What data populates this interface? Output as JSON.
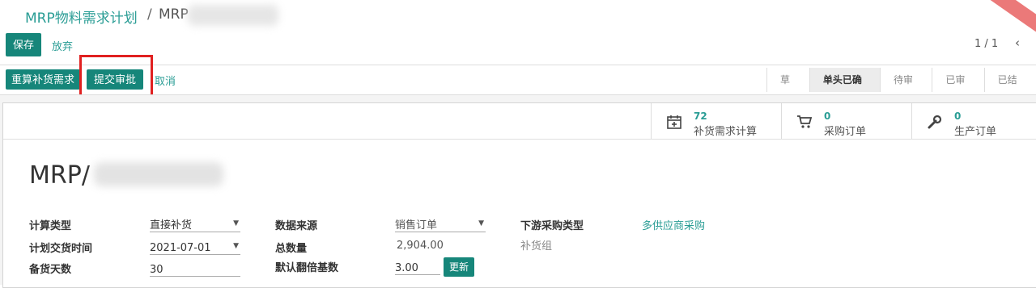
{
  "breadcrumb": {
    "parent": "MRP物料需求计划",
    "separator": "/",
    "current": "MRP"
  },
  "ribbon": "",
  "toolbar": {
    "save": "保存",
    "discard": "放弃",
    "pager": "1 / 1",
    "prev": "‹"
  },
  "actions": {
    "recalc": "重算补货需求",
    "submit": "提交审批",
    "cancel": "取消"
  },
  "status_stages": [
    {
      "label": "草稿",
      "active": false
    },
    {
      "label": "单头已确认",
      "active": true
    },
    {
      "label": "待审批",
      "active": false
    },
    {
      "label": "已审批",
      "active": false
    },
    {
      "label": "已结案",
      "active": false
    }
  ],
  "smart_buttons": [
    {
      "count": "72",
      "label": "补货需求计算",
      "icon": "calendar-plus-icon"
    },
    {
      "count": "0",
      "label": "采购订单",
      "icon": "cart-icon"
    },
    {
      "count": "0",
      "label": "生产订单",
      "icon": "wrench-icon"
    }
  ],
  "record": {
    "title": "MRP/"
  },
  "fields": {
    "calc_type": {
      "label": "计算类型",
      "value": "直接补货"
    },
    "delivery_time": {
      "label": "计划交货时间",
      "value": "2021-07-01"
    },
    "stock_days": {
      "label": "备货天数",
      "value": "30"
    },
    "data_source": {
      "label": "数据来源",
      "value": "销售订单"
    },
    "total_qty": {
      "label": "总数量",
      "value": "2,904.00"
    },
    "multiple": {
      "label": "默认翻倍基数",
      "value": "3.00",
      "button": "更新"
    },
    "downstream": {
      "label": "下游采购类型",
      "value": "多供应商采购"
    },
    "replenish_group": {
      "label": "补货组"
    }
  }
}
